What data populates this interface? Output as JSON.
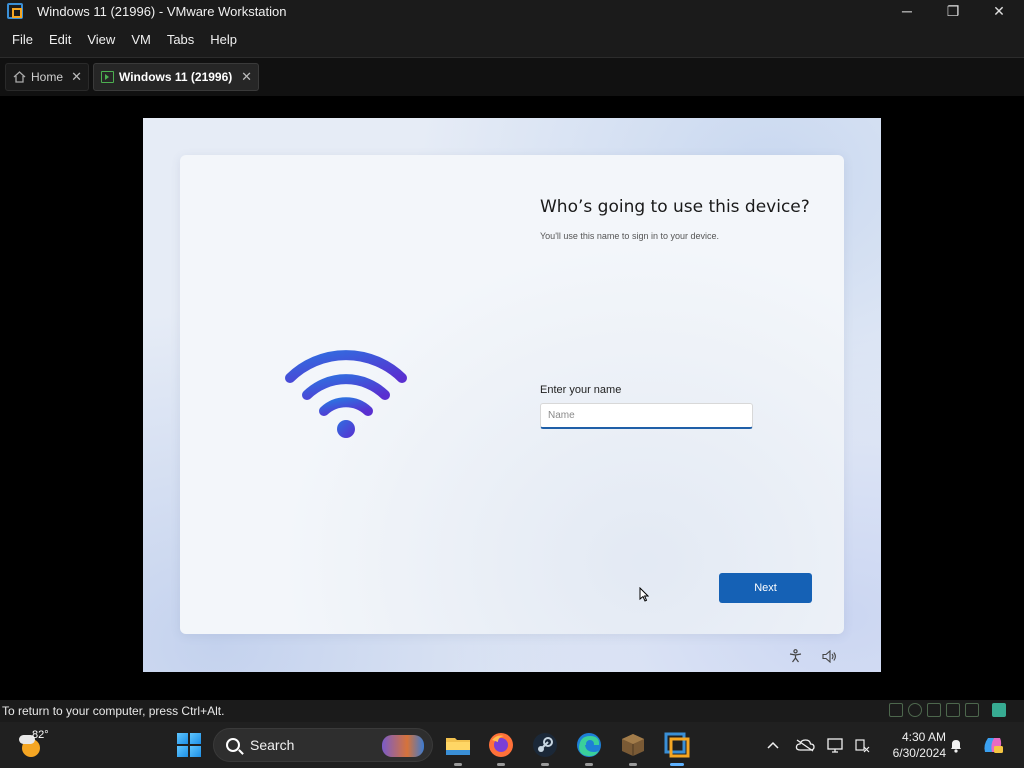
{
  "window": {
    "title": "Windows 11 (21996) - VMware Workstation",
    "minimize_glyph": "─",
    "restore_glyph": "❐",
    "close_glyph": "✕"
  },
  "menu": {
    "items": [
      "File",
      "Edit",
      "View",
      "VM",
      "Tabs",
      "Help"
    ]
  },
  "tabs": [
    {
      "label": "Home",
      "close_glyph": "✕"
    },
    {
      "label": "Windows 11 (21996)",
      "close_glyph": "✕"
    }
  ],
  "oobe": {
    "title": "Who’s going to use this device?",
    "subtitle": "You'll use this name to sign in to your device.",
    "name_label": "Enter your name",
    "name_placeholder": "Name",
    "name_value": "",
    "next_label": "Next",
    "accent_color": "#1561b5"
  },
  "statusbar": {
    "text": "To return to your computer, press Ctrl+Alt."
  },
  "taskbar": {
    "weather_temp": "82°",
    "search_label": "Search",
    "apps": [
      "file-explorer",
      "firefox",
      "steam",
      "edge",
      "minecraft",
      "vmware-workstation"
    ],
    "clock_time": "4:30 AM",
    "clock_date": "6/30/2024"
  }
}
